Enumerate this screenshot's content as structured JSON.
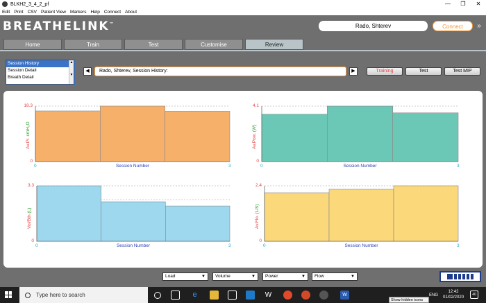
{
  "window": {
    "title": "BLKH2_3_4_2_pf",
    "controls": [
      "—",
      "❐",
      "✕"
    ]
  },
  "menu": [
    "Edit",
    "Print",
    "CSV",
    "Patient View",
    "Markers",
    "Help",
    "Connect",
    "About"
  ],
  "header": {
    "logo": "BREATHELINK",
    "logo_tm": "™",
    "user": "Rado, Shterev",
    "connect": "Connect",
    "chevron": "»"
  },
  "tabs": [
    "Home",
    "Train",
    "Test",
    "Customise",
    "Review"
  ],
  "active_tab": "Review",
  "history_list": {
    "options": [
      "Session History",
      "Session Detail",
      "Breath Detail"
    ],
    "selected": "Session History"
  },
  "nav": {
    "prev": "◀",
    "next": "▶",
    "path": "Rado, Shterev, Session History:"
  },
  "mode_buttons": [
    "Training",
    "Test",
    "Test MIP"
  ],
  "active_mode": "Training",
  "colors": {
    "orange": "#f6b06a",
    "teal": "#6cc8b6",
    "blue": "#9dd8ef",
    "yellow": "#fbd97a",
    "accent": "#f39a3b"
  },
  "chart_data": [
    {
      "type": "bar",
      "quantity": "Av.Pr.",
      "unit": "cmH₂O",
      "ylim": [
        0,
        18.3
      ],
      "ytick_top": "18.3",
      "ytick_bottom": "0",
      "x": [
        0,
        1,
        2,
        3
      ],
      "xtick_left": "0",
      "xtick_right": "3",
      "xlabel": "Session Number",
      "values": [
        16.7,
        18.3,
        16.6
      ],
      "color": "#f6b06a"
    },
    {
      "type": "bar",
      "quantity": "Av.Pow.",
      "unit": "(W)",
      "ylim": [
        0,
        4.1
      ],
      "ytick_top": "4.1",
      "ytick_bottom": "0",
      "x": [
        0,
        1,
        2,
        3
      ],
      "xtick_left": "0",
      "xtick_right": "3",
      "xlabel": "Session Number",
      "values": [
        3.5,
        4.1,
        3.6
      ],
      "color": "#6cc8b6"
    },
    {
      "type": "bar",
      "quantity": "Vol/Bth",
      "unit": "(L)",
      "ylim": [
        0,
        3.3
      ],
      "ytick_top": "3.3",
      "ytick_bottom": "0",
      "x": [
        0,
        1,
        2,
        3
      ],
      "xtick_left": "0",
      "xtick_right": "3",
      "xlabel": "Session Number",
      "values": [
        3.3,
        2.35,
        2.1
      ],
      "color": "#9dd8ef"
    },
    {
      "type": "bar",
      "quantity": "Av.Flo.",
      "unit": "(L/S)",
      "ylim": [
        0,
        2.4
      ],
      "ytick_top": "2.4",
      "ytick_bottom": "0",
      "x": [
        0,
        1,
        2,
        3
      ],
      "xtick_left": "0",
      "xtick_right": "3",
      "xlabel": "Session Number",
      "values": [
        2.1,
        2.25,
        2.4
      ],
      "color": "#fbd97a"
    }
  ],
  "bottom_dropdowns": [
    "Load",
    "Volume",
    "Power",
    "Flow"
  ],
  "taskbar": {
    "search": "Type here to search",
    "tooltip": "Show hidden icons",
    "lang": "ENG",
    "time": "12:42",
    "date": "01/02/2020",
    "notif": "40"
  }
}
